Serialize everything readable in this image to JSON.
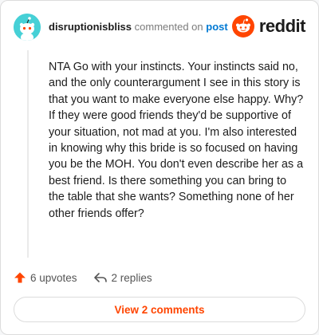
{
  "header": {
    "username": "disruptionisbliss",
    "action_text": "commented on",
    "post_link": "post",
    "logo_text": "reddit"
  },
  "comment": {
    "body": "NTA Go with your instincts. Your instincts said no, and the only counterargument I see in this story is that you want to make everyone else happy. Why? If they were good friends they'd be supportive of your situation, not mad at you. I'm also interested in knowing why this bride is so focused on having you be the MOH. You don't even describe her as a best friend. Is there something you can bring to the table that she wants? Something none of her other friends offer?"
  },
  "actions": {
    "upvotes": "6 upvotes",
    "replies": "2 replies"
  },
  "view_comments": "View 2 comments",
  "icons": {
    "avatar": "snoo-avatar-icon",
    "logo": "reddit-logo-icon",
    "upvote": "upvote-arrow-icon",
    "reply": "reply-arrow-icon"
  },
  "colors": {
    "accent": "#ff4500",
    "link": "#0079d3",
    "avatar_bg": "#46d0d6"
  }
}
